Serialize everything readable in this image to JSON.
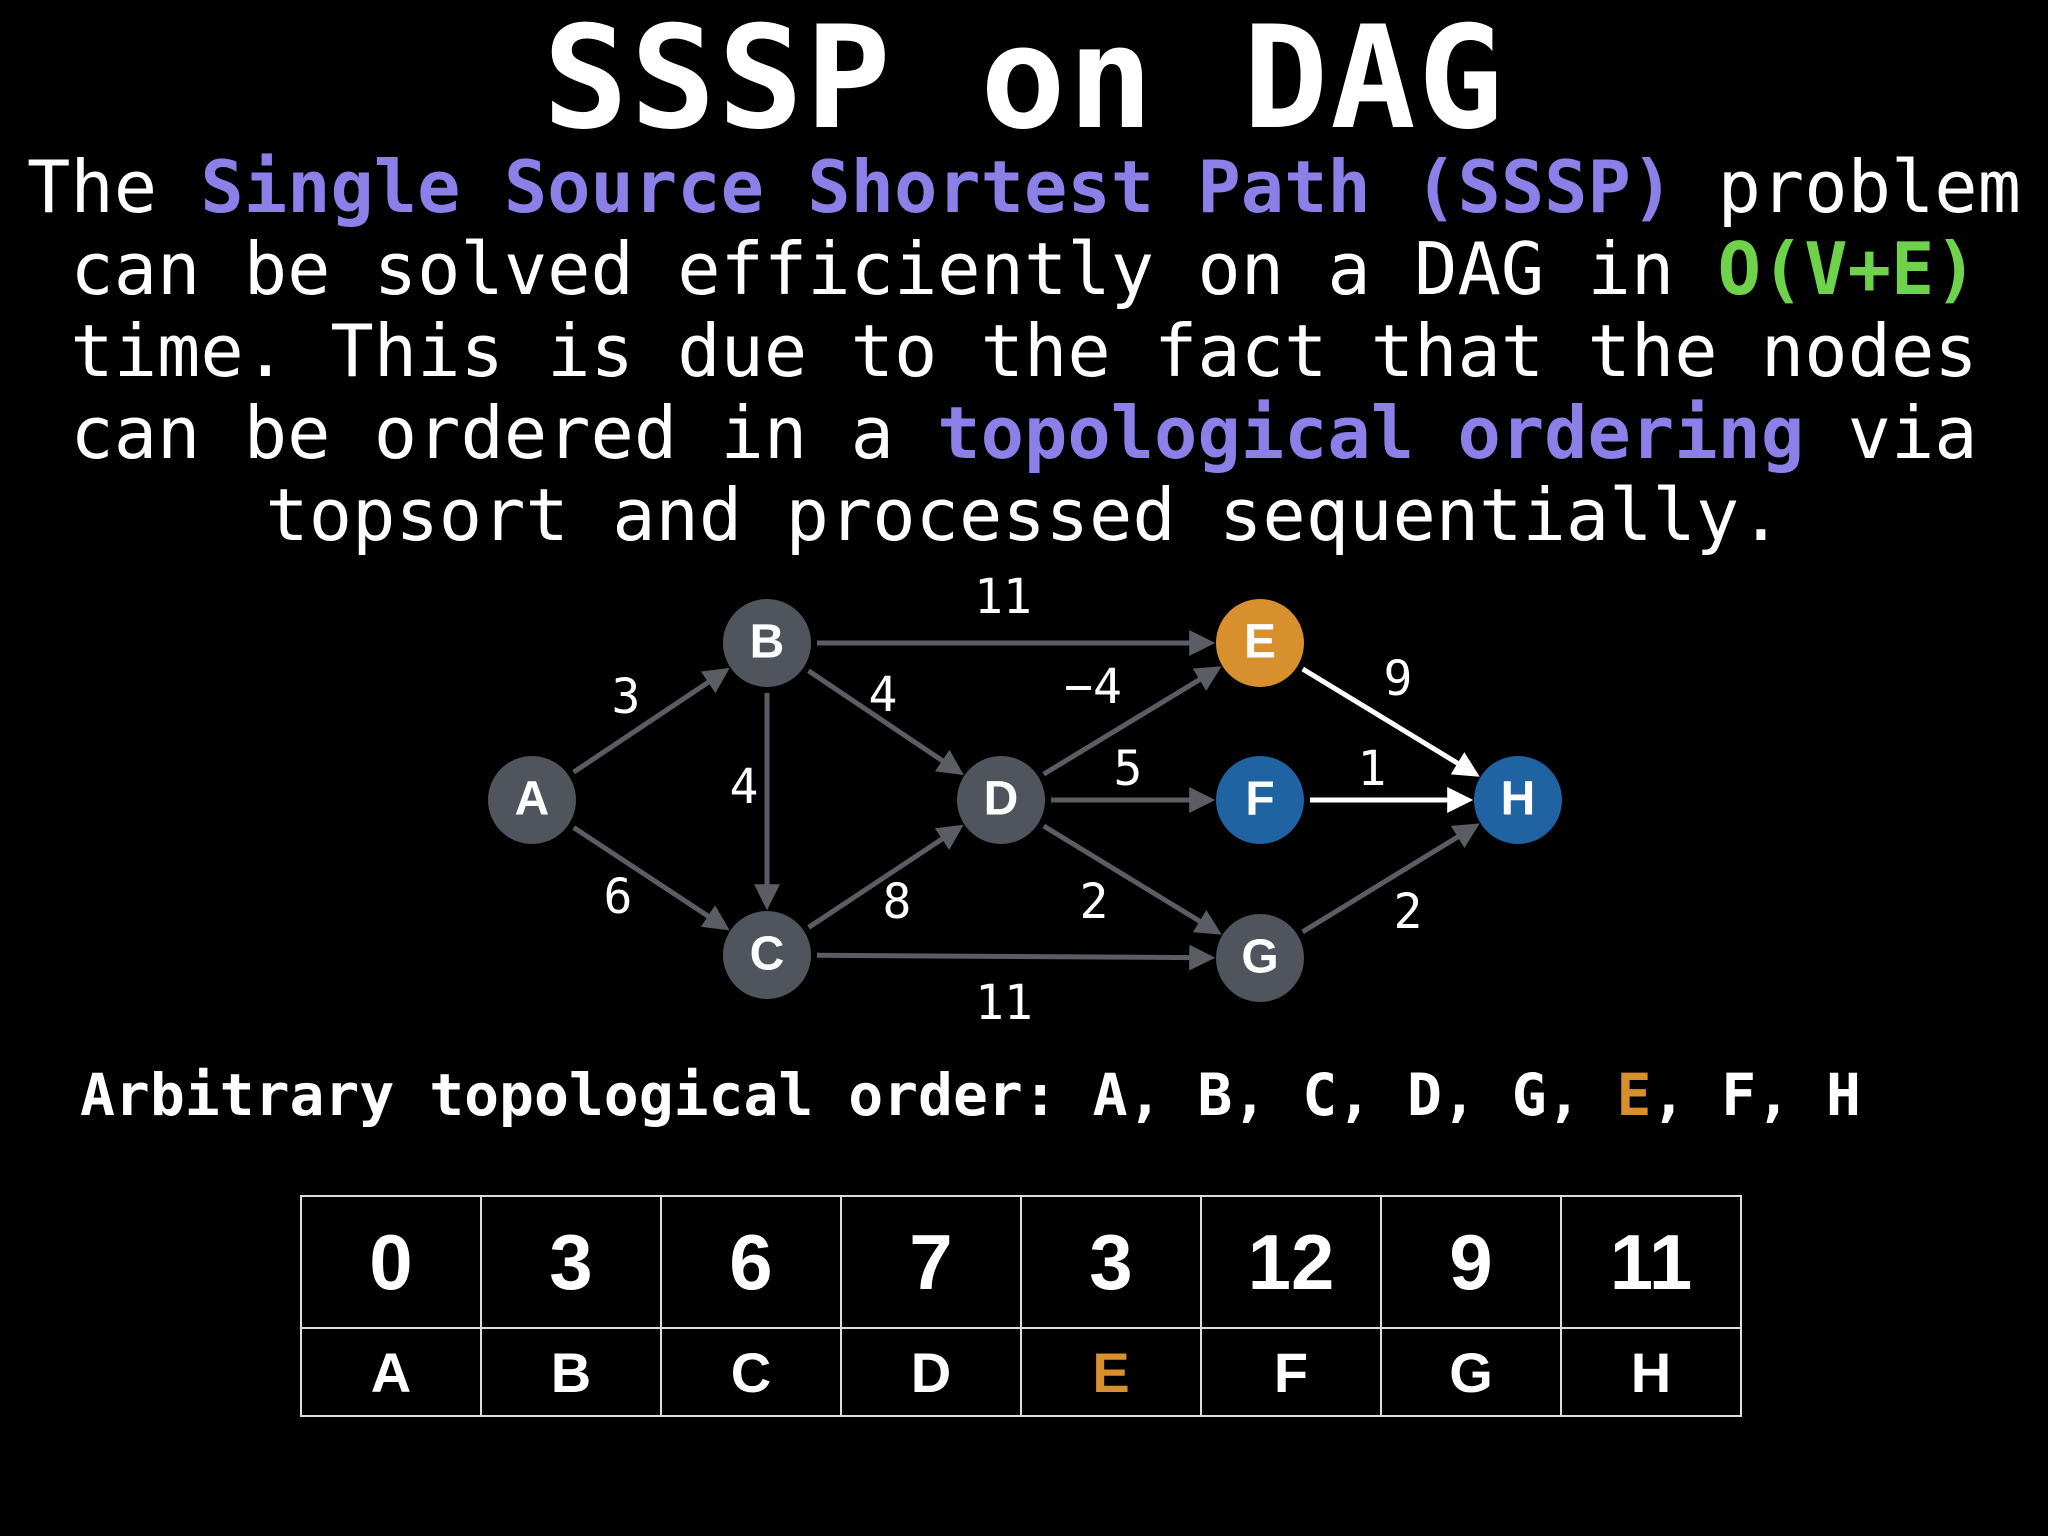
{
  "title": "SSSP on DAG",
  "description": {
    "l1": {
      "a": "The ",
      "b": "Single Source Shortest Path (SSSP)",
      "c": " problem"
    },
    "l2": {
      "a": "can be solved efficiently on a DAG in ",
      "b": "O(V+E)"
    },
    "l3": "time. This is due to the fact that the nodes",
    "l4": {
      "a": "can be ordered in a ",
      "b": "topological ordering",
      "c": " via"
    },
    "l5": "topsort and processed sequentially."
  },
  "colors": {
    "highlight_purple": "#8b7fe8",
    "highlight_green": "#6ed34a",
    "orange": "#d88f2e",
    "node_gray": "#50545c",
    "node_blue": "#1f63a3",
    "edge_gray": "#5a5d63",
    "edge_white": "#ffffff"
  },
  "graph": {
    "nodes": [
      {
        "id": "A",
        "label": "A",
        "color": "gray"
      },
      {
        "id": "B",
        "label": "B",
        "color": "gray"
      },
      {
        "id": "C",
        "label": "C",
        "color": "gray"
      },
      {
        "id": "D",
        "label": "D",
        "color": "gray"
      },
      {
        "id": "E",
        "label": "E",
        "color": "orange"
      },
      {
        "id": "F",
        "label": "F",
        "color": "blue"
      },
      {
        "id": "G",
        "label": "G",
        "color": "gray"
      },
      {
        "id": "H",
        "label": "H",
        "color": "blue"
      }
    ],
    "edges": [
      {
        "from": "A",
        "to": "B",
        "weight": "3",
        "style": "gray"
      },
      {
        "from": "A",
        "to": "C",
        "weight": "6",
        "style": "gray"
      },
      {
        "from": "B",
        "to": "E",
        "weight": "11",
        "style": "gray"
      },
      {
        "from": "B",
        "to": "D",
        "weight": "4",
        "style": "gray"
      },
      {
        "from": "B",
        "to": "C",
        "weight": "4",
        "style": "gray"
      },
      {
        "from": "C",
        "to": "D",
        "weight": "8",
        "style": "gray"
      },
      {
        "from": "C",
        "to": "G",
        "weight": "11",
        "style": "gray"
      },
      {
        "from": "D",
        "to": "E",
        "weight": "−4",
        "style": "gray"
      },
      {
        "from": "D",
        "to": "F",
        "weight": "5",
        "style": "gray"
      },
      {
        "from": "D",
        "to": "G",
        "weight": "2",
        "style": "gray"
      },
      {
        "from": "E",
        "to": "H",
        "weight": "9",
        "style": "white"
      },
      {
        "from": "F",
        "to": "H",
        "weight": "1",
        "style": "white"
      },
      {
        "from": "G",
        "to": "H",
        "weight": "2",
        "style": "gray"
      }
    ]
  },
  "order": {
    "label": "Arbitrary topological order: ",
    "items": [
      "A",
      "B",
      "C",
      "D",
      "G",
      "E",
      "F",
      "H"
    ],
    "highlight": "E"
  },
  "distance_table": {
    "values": [
      "0",
      "3",
      "6",
      "7",
      "3",
      "12",
      "9",
      "11"
    ],
    "nodes": [
      "A",
      "B",
      "C",
      "D",
      "E",
      "F",
      "G",
      "H"
    ],
    "highlight_node": "E"
  }
}
